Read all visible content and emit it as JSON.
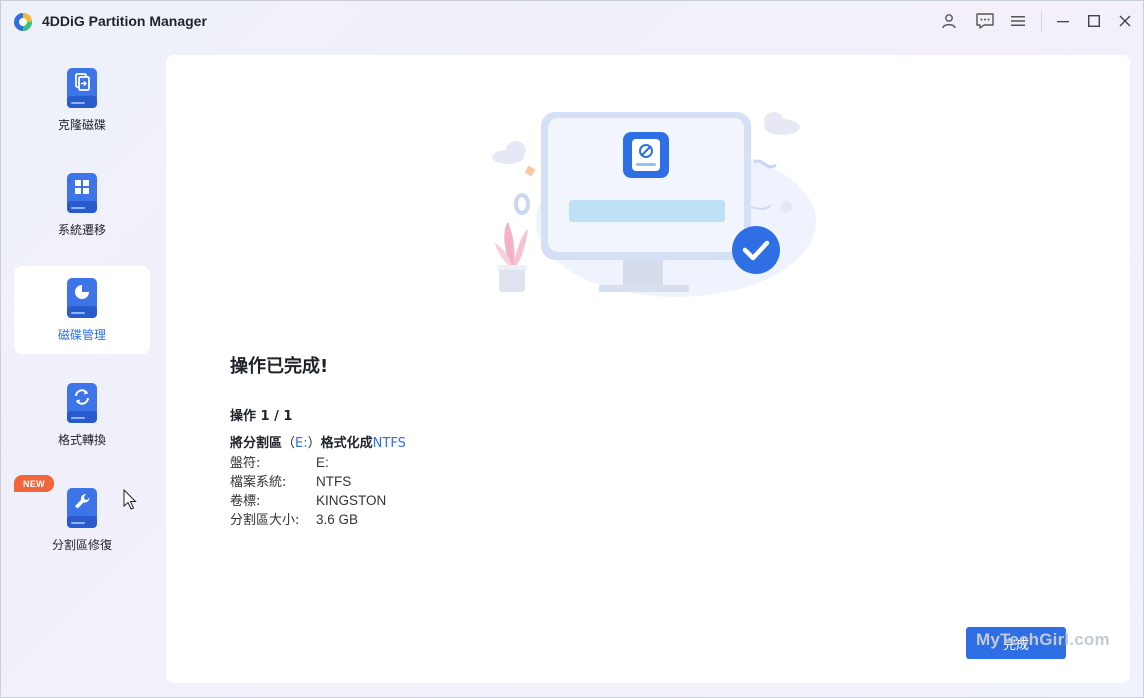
{
  "app": {
    "title": "4DDiG Partition Manager"
  },
  "sidebar": {
    "items": [
      {
        "label": "克隆磁碟",
        "icon": "clone-disk-icon"
      },
      {
        "label": "系統遷移",
        "icon": "system-migrate-icon"
      },
      {
        "label": "磁碟管理",
        "icon": "disk-manage-icon",
        "active": true
      },
      {
        "label": "格式轉換",
        "icon": "format-convert-icon"
      },
      {
        "label": "分割區修復",
        "icon": "partition-repair-icon"
      }
    ],
    "new_badge": "NEW"
  },
  "main": {
    "done_title": "操作已完成!",
    "op_count": "操作 1 / 1",
    "op_line": {
      "prefix": "將分割區",
      "paren_open": "（",
      "drive": "E:",
      "paren_close": "）",
      "action": "格式化成",
      "fs": "NTFS"
    },
    "details": [
      {
        "key": "盤符:",
        "value": "E:"
      },
      {
        "key": "檔案系統:",
        "value": "NTFS"
      },
      {
        "key": "卷標:",
        "value": "KINGSTON"
      },
      {
        "key": "分割區大小:",
        "value": "3.6 GB"
      }
    ],
    "finish_button": "完成"
  },
  "watermark": "MyTechGirl.com",
  "colors": {
    "accent": "#2f6fe6",
    "badge": "#f2653a"
  }
}
